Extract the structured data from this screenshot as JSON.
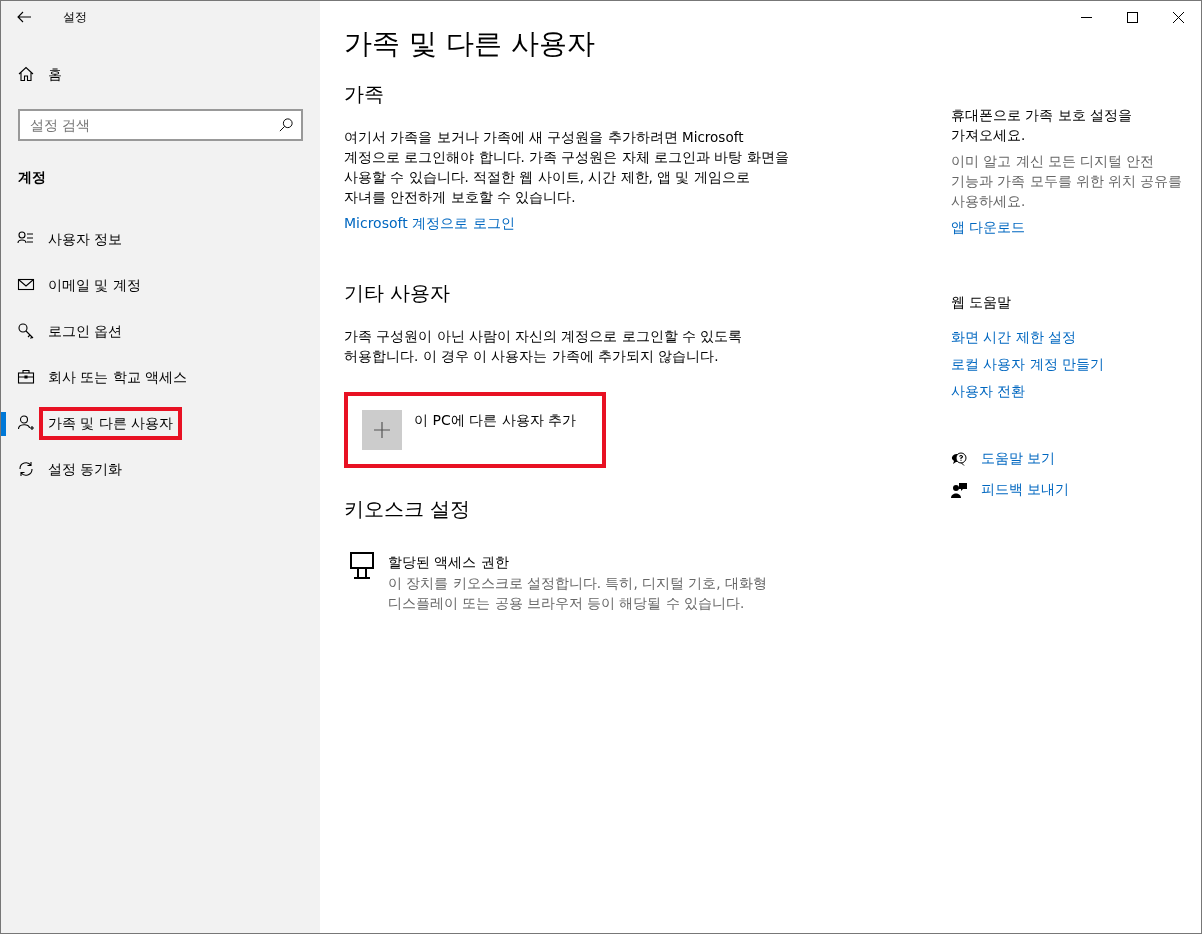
{
  "window": {
    "title": "설정"
  },
  "sidebar": {
    "home": "홈",
    "search": {
      "placeholder": "설정 검색"
    },
    "section": "계정",
    "items": [
      {
        "label": "사용자 정보",
        "selected": false,
        "highlighted": false
      },
      {
        "label": "이메일 및 계정",
        "selected": false,
        "highlighted": false
      },
      {
        "label": "로그인 옵션",
        "selected": false,
        "highlighted": false
      },
      {
        "label": "회사 또는 학교 액세스",
        "selected": false,
        "highlighted": false
      },
      {
        "label": "가족 및 다른 사용자",
        "selected": true,
        "highlighted": true
      },
      {
        "label": "설정 동기화",
        "selected": false,
        "highlighted": false
      }
    ]
  },
  "page_title": "가족 및 다른 사용자",
  "family": {
    "heading": "가족",
    "text": "여기서 가족을 보거나 가족에 새 구성원을 추가하려면 Microsoft 계정으로 로그인해야 합니다. 가족 구성원은 자체 로그인과 바탕 화면을 사용할 수 있습니다. 적절한 웹 사이트, 시간 제한, 앱 및 게임으로 자녀를 안전하게 보호할 수 있습니다.",
    "link": "Microsoft 계정으로 로그인"
  },
  "other_users": {
    "heading": "기타 사용자",
    "text": "가족 구성원이 아닌 사람이 자신의 계정으로 로그인할 수 있도록 허용합니다. 이 경우 이 사용자는 가족에 추가되지 않습니다.",
    "add_button": {
      "label": "이 PC에 다른 사용자 추가",
      "highlighted": true
    }
  },
  "kiosk": {
    "heading": "키오스크 설정",
    "item": {
      "title": "할당된 액세스 권한",
      "description": "이 장치를 키오스크로 설정합니다. 특히, 디지털 기호, 대화형 디스플레이 또는 공용 브라우저 등이 해당될 수 있습니다."
    }
  },
  "side_panel": {
    "promo": {
      "heading": "휴대폰으로 가족 보호 설정을 가져오세요.",
      "text": "이미 알고 계신 모든 디지털 안전 기능과 가족 모두를 위한 위치 공유를 사용하세요.",
      "link": "앱 다운로드"
    },
    "web_help": {
      "heading": "웹 도움말",
      "links": [
        "화면 시간 제한 설정",
        "로컬 사용자 계정 만들기",
        "사용자 전환"
      ]
    },
    "actions": [
      {
        "label": "도움말 보기"
      },
      {
        "label": "피드백 보내기"
      }
    ]
  }
}
